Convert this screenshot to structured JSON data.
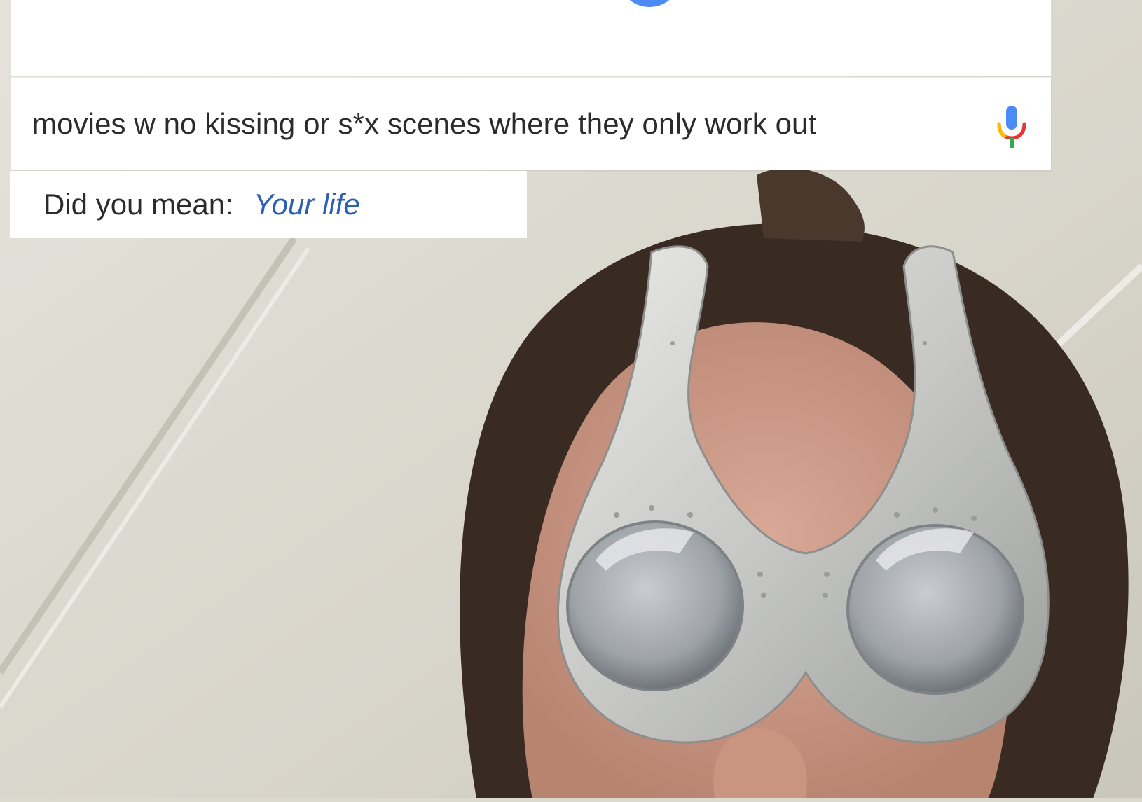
{
  "search": {
    "query": "movies w no kissing or s*x scenes where they only work out"
  },
  "suggestion": {
    "prefix": "Did you mean:",
    "text": "Your life"
  },
  "icons": {
    "mic": "microphone-icon",
    "blue_dot": "assistant-dot-icon"
  },
  "colors": {
    "link": "#2f5fb3",
    "mic_blue": "#4c8bf5",
    "mic_red": "#e53935",
    "mic_yellow": "#fbbc05",
    "mic_green": "#34a853"
  }
}
